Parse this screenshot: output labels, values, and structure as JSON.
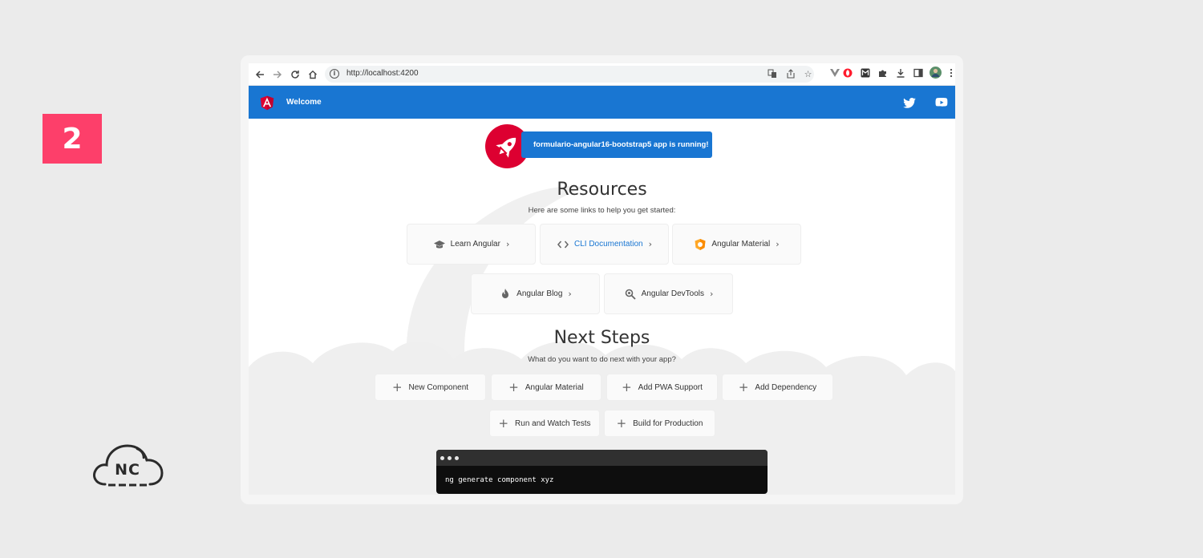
{
  "slide": {
    "step_number": "2",
    "brand_logo_text": "NC"
  },
  "browser": {
    "url": "http://localhost:4200",
    "nav": {
      "back_icon": "arrow-left-icon",
      "forward_icon": "arrow-right-icon",
      "reload_icon": "reload-icon",
      "home_icon": "home-icon"
    },
    "omnibox_icons": [
      "translate-icon",
      "share-icon",
      "star-icon"
    ],
    "extension_icons": [
      "vuejs-extension-icon",
      "opera-extension-icon",
      "mail-extension-icon",
      "puzzle-extensions-icon",
      "download-icon",
      "side-panel-icon",
      "profile-avatar",
      "more-menu-icon"
    ]
  },
  "app": {
    "toolbar": {
      "title": "Welcome",
      "color": "#1976d2",
      "icons": [
        "twitter-icon",
        "youtube-icon"
      ]
    },
    "running_message": "formulario-angular16-bootstrap5 app is running!",
    "resources": {
      "title": "Resources",
      "subtitle": "Here are some links to help you get started:",
      "cards": [
        {
          "label": "Learn Angular",
          "icon": "graduation-cap-icon"
        },
        {
          "label": "CLI Documentation",
          "icon": "code-brackets-icon"
        },
        {
          "label": "Angular Material",
          "icon": "angular-material-icon"
        },
        {
          "label": "Angular Blog",
          "icon": "flame-icon"
        },
        {
          "label": "Angular DevTools",
          "icon": "magnifier-icon"
        }
      ]
    },
    "next_steps": {
      "title": "Next Steps",
      "subtitle": "What do you want to do next with your app?",
      "cards": [
        {
          "label": "New Component"
        },
        {
          "label": "Angular Material"
        },
        {
          "label": "Add PWA Support"
        },
        {
          "label": "Add Dependency"
        },
        {
          "label": "Run and Watch Tests"
        },
        {
          "label": "Build for Production"
        }
      ]
    },
    "terminal": {
      "command": "ng generate component xyz"
    },
    "colors": {
      "angular_red": "#dd0031",
      "primary_blue": "#1976d2",
      "badge_pink": "#fd3f6a"
    }
  }
}
